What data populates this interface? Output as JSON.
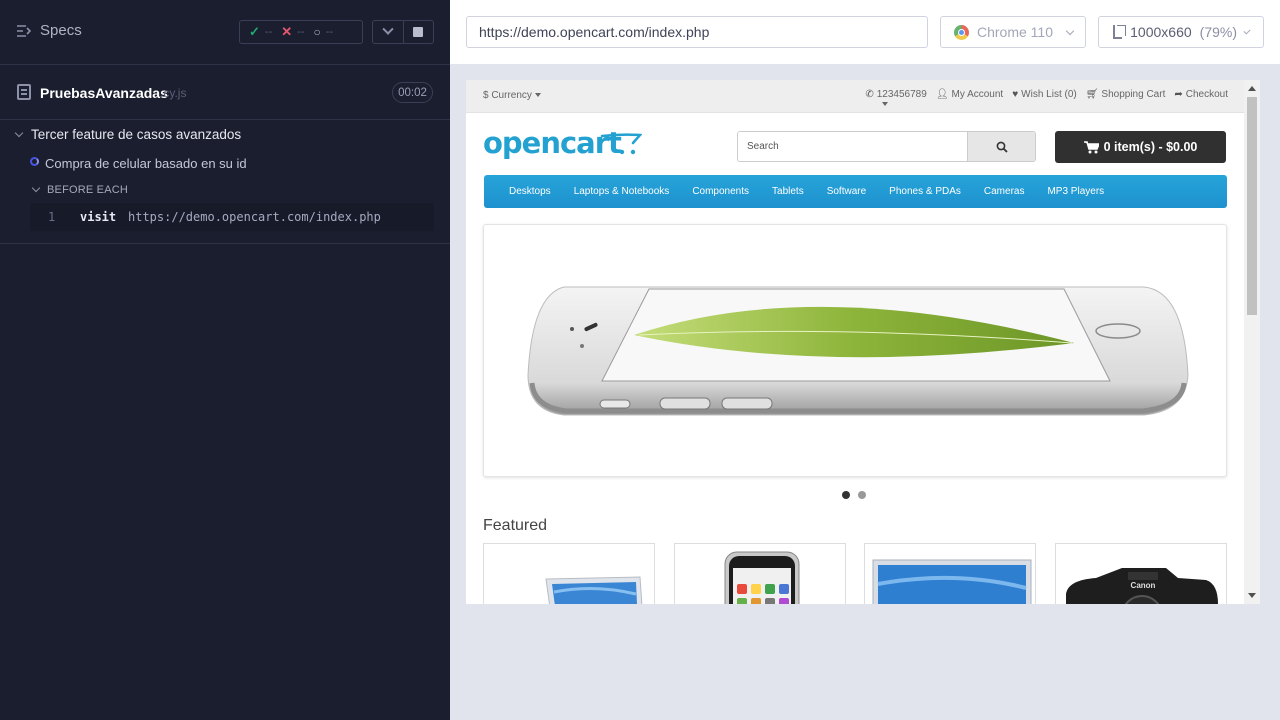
{
  "reporter": {
    "specs_label": "Specs",
    "stats": {
      "passed": "--",
      "failed": "--",
      "pending": "--"
    },
    "spec": {
      "name": "PruebasAvanzadas",
      "ext": ".cy.js",
      "duration": "00:02"
    },
    "suite": {
      "title": "Tercer feature de casos avanzados",
      "test": "Compra de celular basado en su id",
      "hook": "BEFORE EACH",
      "command": {
        "number": "1",
        "name": "visit",
        "message": "https://demo.opencart.com/index.php"
      }
    }
  },
  "aut": {
    "url": "https://demo.opencart.com/index.php",
    "browser": "Chrome 110",
    "viewport": "1000x660",
    "scale": "(79%)"
  },
  "site": {
    "currency": "$ Currency",
    "phone": "123456789",
    "my_account": "My Account",
    "wish_list": "Wish List (0)",
    "shopping_cart": "Shopping Cart",
    "checkout": "Checkout",
    "logo": "opencart",
    "search_placeholder": "Search",
    "cart_button": "0 item(s) - $0.00",
    "menu": [
      "Desktops",
      "Laptops & Notebooks",
      "Components",
      "Tablets",
      "Software",
      "Phones & PDAs",
      "Cameras",
      "MP3 Players"
    ],
    "featured_heading": "Featured",
    "products": [
      {
        "icon": "laptop"
      },
      {
        "icon": "iphone"
      },
      {
        "icon": "monitor"
      },
      {
        "icon": "camera"
      }
    ],
    "slider": {
      "slides": 2,
      "active_slide": 1
    }
  },
  "colors": {
    "reporter_bg": "#1b1e2e",
    "opencart_blue": "#23a1d1",
    "pass": "#1fa971",
    "fail": "#e45770",
    "running": "#4956e3"
  }
}
